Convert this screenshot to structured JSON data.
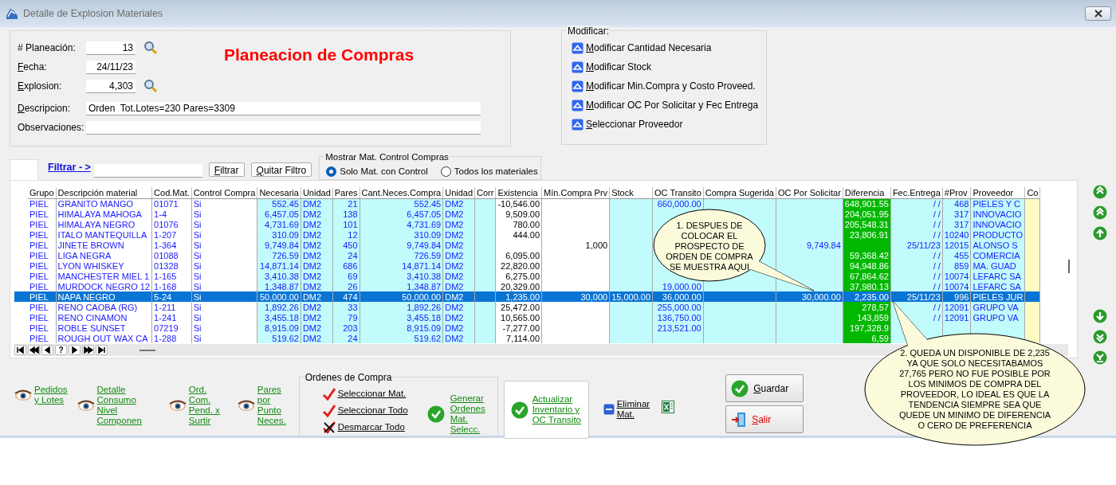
{
  "window": {
    "title": "Detalle de Explosion Materiales"
  },
  "header": {
    "heading": "Planeacion de Compras",
    "fields": [
      {
        "label": "# Planeación:",
        "mnemonic": false,
        "value": "13",
        "kind": "short",
        "search": true
      },
      {
        "label": "Fecha:",
        "mnemonic": true,
        "value": "24/11/23",
        "kind": "short",
        "search": false
      },
      {
        "label": "Explosion:",
        "mnemonic": true,
        "value": "4,303",
        "kind": "short",
        "search": true
      },
      {
        "label": "Descripcion:",
        "mnemonic": true,
        "value": "Orden  Tot.Lotes=230 Pares=3309",
        "kind": "long",
        "search": false
      },
      {
        "label": "Observaciones:",
        "mnemonic": false,
        "kind": "long",
        "search": false
      }
    ]
  },
  "modificar": {
    "title": "Modificar:",
    "items": [
      "Modificar Cantidad Necesaria",
      "Modificar Stock",
      "Modificar Min.Compra y Costo Proveed.",
      "Modificar OC Por Solicitar y Fec Entrega",
      "Seleccionar Proveedor"
    ]
  },
  "filter": {
    "label": "Filtrar - >",
    "buttons": [
      "Filtrar",
      "Quitar Filtro"
    ],
    "group": "Mostrar Mat. Control Compras",
    "options": [
      {
        "label": "Solo Mat. con Control",
        "selected": true
      },
      {
        "label": "Todos los materiales",
        "selected": false
      }
    ]
  },
  "table": {
    "columns": [
      "Grupo",
      "Descripción material",
      "Cod.Mat.",
      "Control Compra",
      "Necesaria",
      "Unidad",
      "Pares",
      "Cant.Neces.Compra",
      "Unidad",
      "Corr",
      "Existencia",
      "Mín.Compra Prv",
      "Stock",
      "OC Transito",
      "Compra Sugerida",
      "OC Por Solicitar",
      "Diferencia",
      "Fec.Entrega",
      "#Prov",
      "Proveedor",
      "Co"
    ],
    "rows": [
      {
        "selected": false,
        "cells": [
          "PIEL",
          "GRANITO MANGO",
          "01071",
          "Si",
          "552.45",
          "DM2",
          "21",
          "552.45",
          "DM2",
          null,
          "-10,546.00",
          null,
          null,
          "660,000.00",
          null,
          null,
          "648,901.55",
          "/ /",
          "468",
          "PIELES Y C",
          null
        ]
      },
      {
        "selected": false,
        "cells": [
          "PIEL",
          "HIMALAYA MAHOGA",
          "1-4",
          "Si",
          "6,457.05",
          "DM2",
          "138",
          "6,457.05",
          "DM2",
          null,
          "9,509.00",
          null,
          null,
          null,
          null,
          null,
          "204,051.95",
          "/ /",
          "317",
          "INNOVACIO",
          null
        ]
      },
      {
        "selected": false,
        "cells": [
          "PIEL",
          "HIMALAYA NEGRO",
          "01076",
          "Si",
          "4,731.69",
          "DM2",
          "101",
          "4,731.69",
          "DM2",
          null,
          "780.00",
          null,
          null,
          null,
          null,
          null,
          "205,548.31",
          "/ /",
          "317",
          "INNOVACIO",
          null
        ]
      },
      {
        "selected": false,
        "cells": [
          "PIEL",
          "ITALO MANTEQUILLA",
          "1-207",
          "Si",
          "310.09",
          "DM2",
          "12",
          "310.09",
          "DM2",
          null,
          "444.00",
          null,
          null,
          null,
          null,
          null,
          "23,806.91",
          "/ /",
          "10240",
          "PRODUCTO",
          null
        ]
      },
      {
        "selected": false,
        "cells": [
          "PIEL",
          "JINETE BROWN",
          "1-364",
          "Si",
          "9,749.84",
          "DM2",
          "450",
          "9,749.84",
          "DM2",
          null,
          null,
          "1,000",
          null,
          null,
          null,
          "9,749.84",
          null,
          "25/11/23",
          "12015",
          "ALONSO S",
          null
        ]
      },
      {
        "selected": false,
        "cells": [
          "PIEL",
          "LIGA NEGRA",
          "01088",
          "Si",
          "726.59",
          "DM2",
          "24",
          "726.59",
          "DM2",
          null,
          "6,095.00",
          null,
          null,
          null,
          null,
          null,
          "59,368.42",
          "/ /",
          "455",
          "COMERCIA",
          null
        ]
      },
      {
        "selected": false,
        "cells": [
          "PIEL",
          "LYON WHISKEY",
          "01328",
          "Si",
          "14,871.14",
          "DM2",
          "686",
          "14,871.14",
          "DM2",
          null,
          "22,820.00",
          null,
          null,
          null,
          null,
          null,
          "94,948.86",
          "/ /",
          "859",
          "MA. GUAD",
          null
        ]
      },
      {
        "selected": false,
        "cells": [
          "PIEL",
          "MANCHESTER MIEL 1",
          "1-165",
          "Si",
          "3,410.38",
          "DM2",
          "69",
          "3,410.38",
          "DM2",
          null,
          "6,275.00",
          null,
          null,
          null,
          null,
          null,
          "67,864.62",
          "/ /",
          "10074",
          "LEFARC SA",
          null
        ]
      },
      {
        "selected": false,
        "cells": [
          "PIEL",
          "MURDOCK NEGRO 12",
          "1-168",
          "Si",
          "1,348.87",
          "DM2",
          "26",
          "1,348.87",
          "DM2",
          null,
          "20,329.00",
          null,
          null,
          "19,000.00",
          null,
          null,
          "37,980.13",
          "/ /",
          "10074",
          "LEFARC SA",
          null
        ]
      },
      {
        "selected": true,
        "cells": [
          "PIEL",
          "NAPA NEGRO",
          "5-24",
          "Si",
          "50,000.00",
          "DM2",
          "474",
          "50,000.00",
          "DM2",
          null,
          "1,235.00",
          "30,000",
          "15,000.00",
          "36,000.00",
          null,
          "30,000.00",
          "2,235.00",
          "25/11/23",
          "996",
          "PIELES JUR",
          null
        ]
      },
      {
        "selected": false,
        "cells": [
          "PIEL",
          "RENO CAOBA (RG)",
          "1-211",
          "Si",
          "1,892.26",
          "DM2",
          "33",
          "1,892.26",
          "DM2",
          null,
          "25,472.00",
          null,
          null,
          "255,000.00",
          null,
          null,
          "278,57",
          "/ /",
          "12091",
          "GRUPO VA",
          null
        ]
      },
      {
        "selected": false,
        "cells": [
          "PIEL",
          "RENO CINAMON",
          "1-241",
          "Si",
          "3,455.18",
          "DM2",
          "79",
          "3,455.18",
          "DM2",
          null,
          "10,565.00",
          null,
          null,
          "136,750.00",
          null,
          null,
          "143,859",
          "/ /",
          "12091",
          "GRUPO VA",
          null
        ]
      },
      {
        "selected": false,
        "cells": [
          "PIEL",
          "ROBLE SUNSET",
          "07219",
          "Si",
          "8,915.09",
          "DM2",
          "203",
          "8,915.09",
          "DM2",
          null,
          "-7,277.00",
          null,
          null,
          "213,521.00",
          null,
          null,
          "197,328.9",
          null,
          null,
          null,
          null
        ]
      },
      {
        "selected": false,
        "cells": [
          "PIEL",
          "ROUGH OUT WAX CA",
          "1-288",
          "Si",
          "519.62",
          "DM2",
          "24",
          "519.62",
          "DM2",
          null,
          "7,114.00",
          null,
          null,
          null,
          null,
          null,
          "6,59",
          null,
          null,
          null,
          null
        ]
      }
    ],
    "nav_help": "?"
  },
  "callouts": [
    {
      "lines": [
        "1. DESPUES DE",
        "COLOCAR EL",
        "PROSPECTO DE",
        "ORDEN DE COMPRA",
        "SE MUESTRA AQUI"
      ]
    },
    {
      "lines": [
        "2. QUEDA UN DISPONIBLE DE 2,235",
        "YA QUE SOLO NECESITABAMOS",
        "27,765 PERO NO FUE POSIBLE POR",
        "LOS MINIMOS DE COMPRA DEL",
        "PROVEEDOR, LO IDEAL ES QUE LA",
        "TENDENCIA SIEMPRE SEA QUE",
        "QUEDE UN MINIMO DE DIFERENCIA",
        "O CERO DE PREFERENCIA"
      ]
    }
  ],
  "bottom": {
    "links": [
      {
        "lines": [
          "Pedidos",
          "y Lotes"
        ]
      },
      {
        "lines": [
          "Detalle",
          "Consumo",
          "Nivel",
          "Componen"
        ]
      },
      {
        "lines": [
          "Ord.",
          "Com.",
          "Pend. x",
          "Surtir"
        ]
      },
      {
        "lines": [
          "Pares",
          "por",
          "Punto",
          "Neces."
        ]
      }
    ],
    "ordenes": {
      "title": "Ordenes de Compra",
      "items": [
        {
          "kind": "check",
          "text": "Seleccionar Mat."
        },
        {
          "kind": "check",
          "text": "Seleccionar Todo"
        },
        {
          "kind": "uncheck",
          "text": "Desmarcar Todo"
        }
      ],
      "generate": [
        "Generar",
        "Ordenes",
        "Mat.",
        "Selecc."
      ]
    },
    "actualizar": [
      "Actualizar",
      "Inventario y",
      "OC Transito"
    ],
    "eliminar": [
      "Eliminar",
      "Mat."
    ],
    "guardar": "Guardar",
    "salir": "Salir"
  }
}
